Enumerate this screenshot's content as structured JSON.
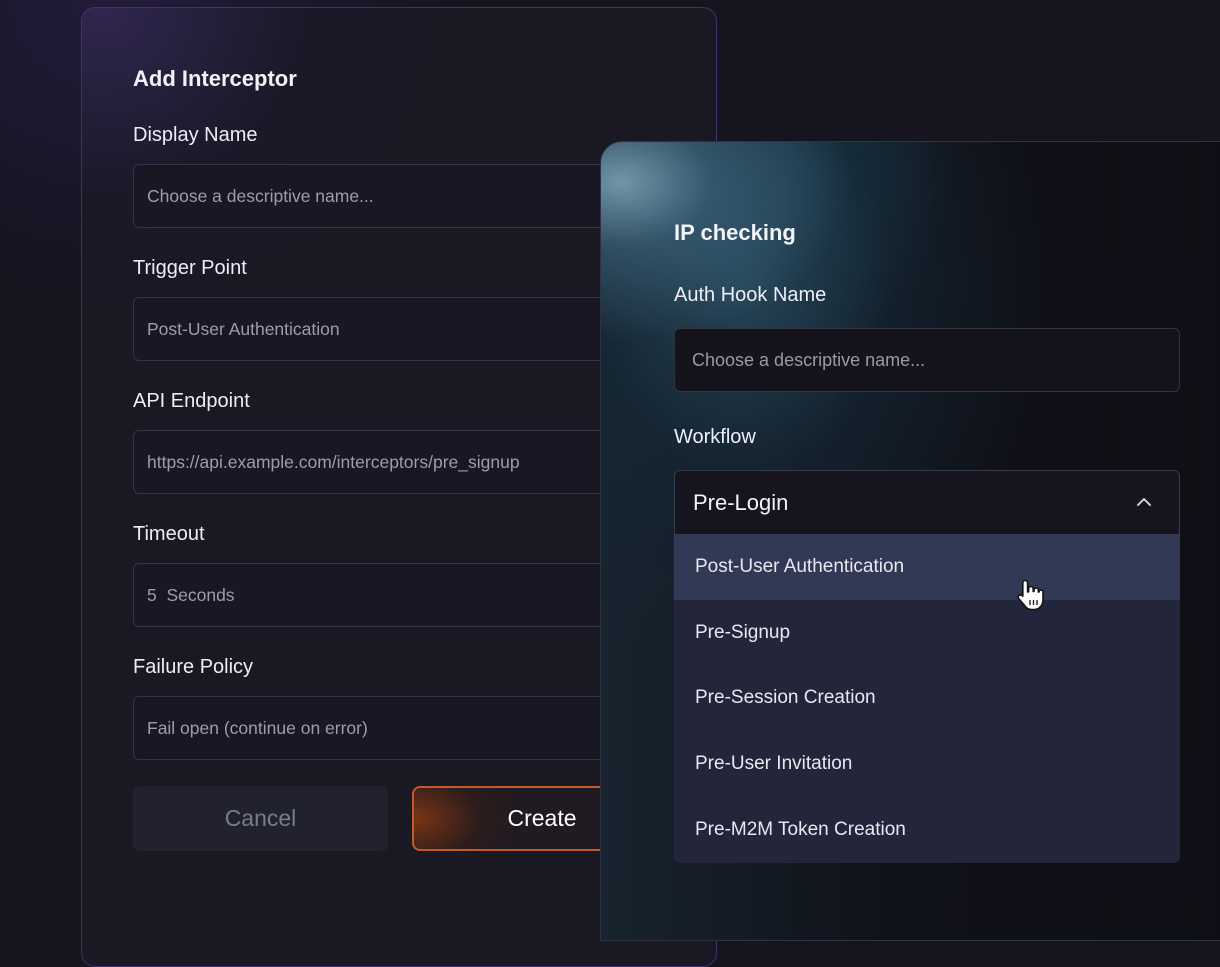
{
  "interceptor_form": {
    "title": "Add Interceptor",
    "fields": [
      {
        "label": "Display Name",
        "value": "",
        "placeholder": "Choose a descriptive name..."
      },
      {
        "label": "Trigger Point",
        "value": "Post-User Authentication",
        "placeholder": ""
      },
      {
        "label": "API Endpoint",
        "value": "",
        "placeholder": "https://api.example.com/interceptors/pre_signup"
      },
      {
        "label": "Timeout",
        "value": "5  Seconds",
        "placeholder": ""
      },
      {
        "label": "Failure Policy",
        "value": "Fail open (continue on error)",
        "placeholder": ""
      }
    ],
    "cancel_label": "Cancel",
    "create_label": "Create"
  },
  "auth_hook_form": {
    "title": "IP checking",
    "name_label": "Auth Hook Name",
    "name_placeholder": "Choose a descriptive name...",
    "workflow_label": "Workflow",
    "workflow_selected": "Pre-Login",
    "workflow_options": [
      "Post-User Authentication",
      "Pre-Signup",
      "Pre-Session Creation",
      "Pre-User Invitation",
      "Pre-M2M Token Creation"
    ],
    "highlighted_option": "Post-User Authentication"
  },
  "icons": {
    "chevron": "chevron-up-icon",
    "cursor": "hand-pointer-cursor-icon"
  },
  "colors": {
    "background": "#15141f",
    "create_accent": "#c05a2a",
    "panel_border": "#3b3372",
    "menu_bg": "#23253a",
    "menu_highlight": "#323954"
  }
}
